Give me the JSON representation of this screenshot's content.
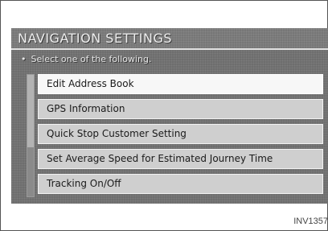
{
  "header": {
    "title": "NAVIGATION SETTINGS"
  },
  "instruction": {
    "bullet": "•",
    "text": "Select one of the following."
  },
  "menu": {
    "items": [
      {
        "label": "Edit Address Book",
        "selected": true
      },
      {
        "label": "GPS Information",
        "selected": false
      },
      {
        "label": "Quick Stop Customer Setting",
        "selected": false
      },
      {
        "label": "Set Average Speed for Estimated Journey Time",
        "selected": false
      },
      {
        "label": "Tracking On/Off",
        "selected": false
      }
    ]
  },
  "figure_ref": "INV1357"
}
